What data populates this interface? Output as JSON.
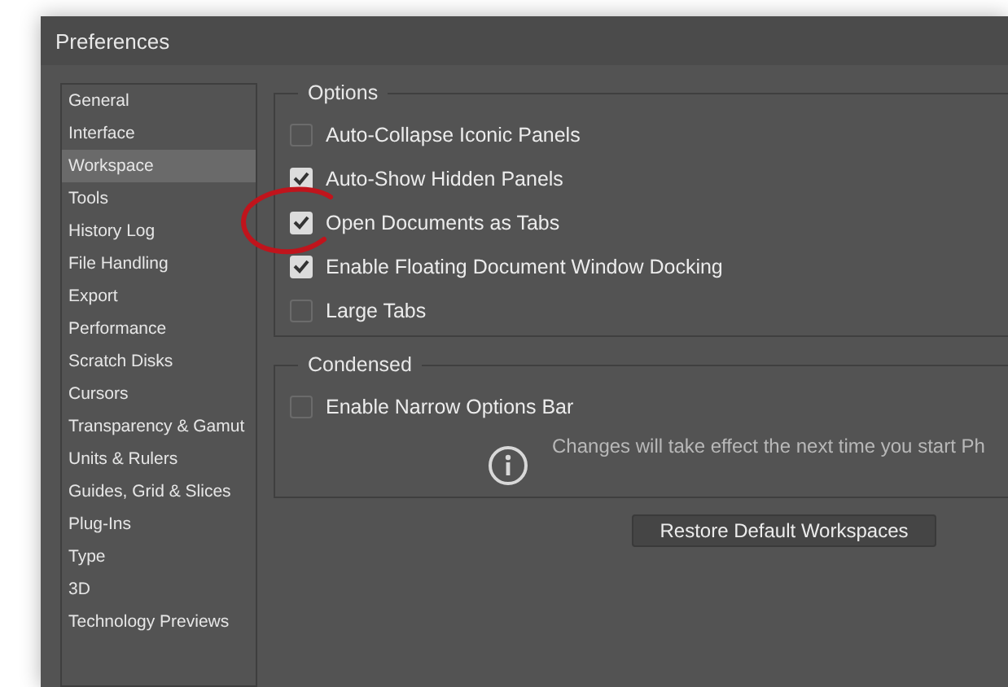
{
  "window": {
    "title": "Preferences"
  },
  "sidebar": {
    "items": [
      {
        "label": "General",
        "selected": false
      },
      {
        "label": "Interface",
        "selected": false
      },
      {
        "label": "Workspace",
        "selected": true
      },
      {
        "label": "Tools",
        "selected": false
      },
      {
        "label": "History Log",
        "selected": false
      },
      {
        "label": "File Handling",
        "selected": false
      },
      {
        "label": "Export",
        "selected": false
      },
      {
        "label": "Performance",
        "selected": false
      },
      {
        "label": "Scratch Disks",
        "selected": false
      },
      {
        "label": "Cursors",
        "selected": false
      },
      {
        "label": "Transparency & Gamut",
        "selected": false
      },
      {
        "label": "Units & Rulers",
        "selected": false
      },
      {
        "label": "Guides, Grid & Slices",
        "selected": false
      },
      {
        "label": "Plug-Ins",
        "selected": false
      },
      {
        "label": "Type",
        "selected": false
      },
      {
        "label": "3D",
        "selected": false
      },
      {
        "label": "Technology Previews",
        "selected": false
      }
    ]
  },
  "options": {
    "title": "Options",
    "items": [
      {
        "label": "Auto-Collapse Iconic Panels",
        "checked": false
      },
      {
        "label": "Auto-Show Hidden Panels",
        "checked": true
      },
      {
        "label": "Open Documents as Tabs",
        "checked": true,
        "annotated": true
      },
      {
        "label": "Enable Floating Document Window Docking",
        "checked": true
      },
      {
        "label": "Large Tabs",
        "checked": false
      }
    ]
  },
  "condensed": {
    "title": "Condensed",
    "items": [
      {
        "label": "Enable Narrow Options Bar",
        "checked": false
      }
    ],
    "note": "Changes will take effect the next time you start Ph"
  },
  "buttons": [
    "Restore Default Workspaces"
  ]
}
